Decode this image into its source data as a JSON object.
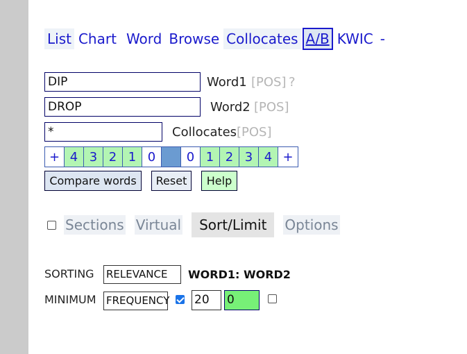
{
  "nav": {
    "tabs": [
      "List",
      "Chart",
      "Word",
      "Browse",
      "Collocates",
      "A/B",
      "KWIC",
      "-"
    ],
    "active": "A/B"
  },
  "search": {
    "word1": {
      "value": "DIP",
      "label": "Word1",
      "pos": "[POS]",
      "help": "?"
    },
    "word2": {
      "value": "DROP",
      "label": "Word2",
      "pos": "[POS]"
    },
    "collocates": {
      "value": "*",
      "label": "Collocates",
      "pos": "[POS]"
    }
  },
  "context": {
    "cells": [
      "+",
      "4",
      "3",
      "2",
      "1",
      "0",
      "",
      "0",
      "1",
      "2",
      "3",
      "4",
      "+"
    ]
  },
  "buttons": {
    "compare": "Compare words",
    "reset": "Reset",
    "help": "Help"
  },
  "options": {
    "items": [
      "Sections",
      "Virtual",
      "Sort/Limit",
      "Options"
    ],
    "active": "Sort/Limit"
  },
  "sorting": {
    "label": "SORTING",
    "value": "RELEVANCE",
    "note": "WORD1: WORD2"
  },
  "minimum": {
    "label": "MINIMUM",
    "value": "FREQUENCY",
    "checked": true,
    "count": "20",
    "extra": "0"
  },
  "colors": {
    "link": "#1a1acc",
    "green": "#b3f5b3",
    "bright_green": "#77f077",
    "node": "#6b9bd1",
    "sidebar": "#cbcbcb"
  }
}
